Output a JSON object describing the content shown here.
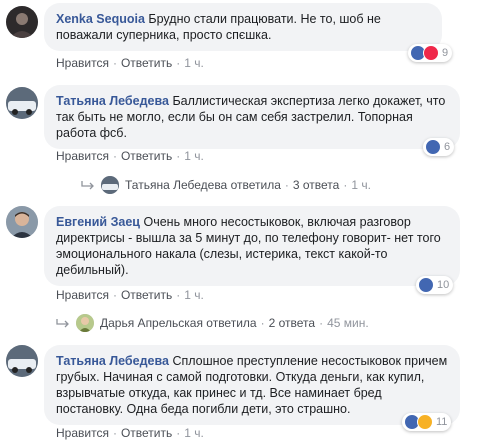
{
  "comments": [
    {
      "author": "Xenka Sequoia",
      "text": "Брудно стали працювати. Не то, шоб не поважали суперника, просто спєшка.",
      "reaction_count": "9",
      "actions": {
        "like": "Нравится",
        "reply": "Ответить",
        "time": "1 ч."
      }
    },
    {
      "author": "Татьяна Лебедева",
      "text": "Баллистическая экспертиза легко докажет, что так быть не могло, если бы он сам себя застрелил. Топорная работа фсб.",
      "reaction_count": "6",
      "actions": {
        "like": "Нравится",
        "reply": "Ответить",
        "time": "1 ч."
      },
      "reply_summary": {
        "name": "Татьяна Лебедева ответила",
        "count": "3 ответа",
        "time": "1 ч."
      }
    },
    {
      "author": "Евгений Заец",
      "text": "Очень много несостыковок, включая разговор директрисы - вышла за 5 минут до, по телефону говорит- нет того эмоционального накала (слезы, истерика, текст какой-то дебильный).",
      "reaction_count": "10",
      "actions": {
        "like": "Нравится",
        "reply": "Ответить",
        "time": "1 ч."
      },
      "reply_summary": {
        "name": "Дарья Апрельская ответила",
        "count": "2 ответа",
        "time": "45 мин."
      }
    },
    {
      "author": "Татьяна Лебедева",
      "text": "Сплошное преступление несостыковок причем грубых. Начиная с самой подготовки. Откуда деньги, как купил, взрывчатые откуда, как принес и тд. Все наминает бред постановку. Одна беда погибли дети, это страшно.",
      "reaction_count": "11",
      "actions": {
        "like": "Нравится",
        "reply": "Ответить",
        "time": "1 ч."
      }
    }
  ],
  "colors": {
    "author": "#385898",
    "bubble": "#f2f3f5",
    "like": "#4267b2",
    "love": "#f0284a",
    "sad": "#f7b125"
  }
}
